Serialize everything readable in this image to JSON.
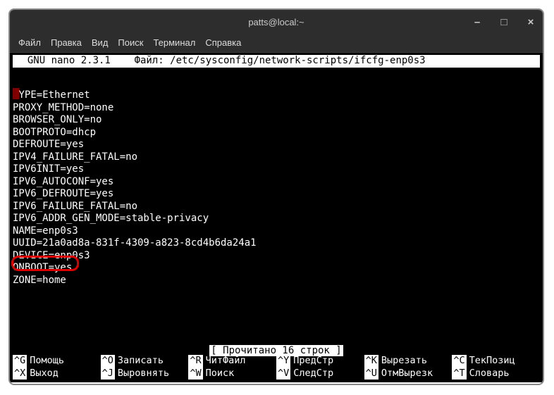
{
  "window": {
    "title": "patts@local:~",
    "minimize": "–",
    "maximize": "□",
    "close": "×"
  },
  "menu": {
    "file": "Файл",
    "edit": "Правка",
    "view": "Вид",
    "search": "Поиск",
    "terminal": "Терминал",
    "help": "Справка"
  },
  "editor": {
    "header": "  GNU nano 2.3.1    Файл: /etc/sysconfig/network-scripts/ifcfg-enp0s3           ",
    "first_char_removed": "YPE=Ethernet",
    "lines": [
      "PROXY_METHOD=none",
      "BROWSER_ONLY=no",
      "BOOTPROTO=dhcp",
      "DEFROUTE=yes",
      "IPV4_FAILURE_FATAL=no",
      "IPV6INIT=yes",
      "IPV6_AUTOCONF=yes",
      "IPV6_DEFROUTE=yes",
      "IPV6_FAILURE_FATAL=no",
      "IPV6_ADDR_GEN_MODE=stable-privacy",
      "NAME=enp0s3",
      "UUID=21a0ad8a-831f-4309-a823-8cd4b6da24a1",
      "DEVICE=enp0s3",
      "ONBOOT=yes",
      "ZONE=home"
    ],
    "status": "[ Прочитано 16 строк ]"
  },
  "shortcuts": {
    "row1": [
      {
        "key": "^G",
        "label": "Помощь"
      },
      {
        "key": "^O",
        "label": "Записать"
      },
      {
        "key": "^R",
        "label": "ЧитФайл"
      },
      {
        "key": "^Y",
        "label": "ПредСтр"
      },
      {
        "key": "^K",
        "label": "Вырезать"
      },
      {
        "key": "^C",
        "label": "ТекПозиц"
      }
    ],
    "row2": [
      {
        "key": "^X",
        "label": "Выход"
      },
      {
        "key": "^J",
        "label": "Выровнять"
      },
      {
        "key": "^W",
        "label": "Поиск"
      },
      {
        "key": "^V",
        "label": "СледСтр"
      },
      {
        "key": "^U",
        "label": "ОтмВырезк"
      },
      {
        "key": "^T",
        "label": "Словарь"
      }
    ]
  }
}
